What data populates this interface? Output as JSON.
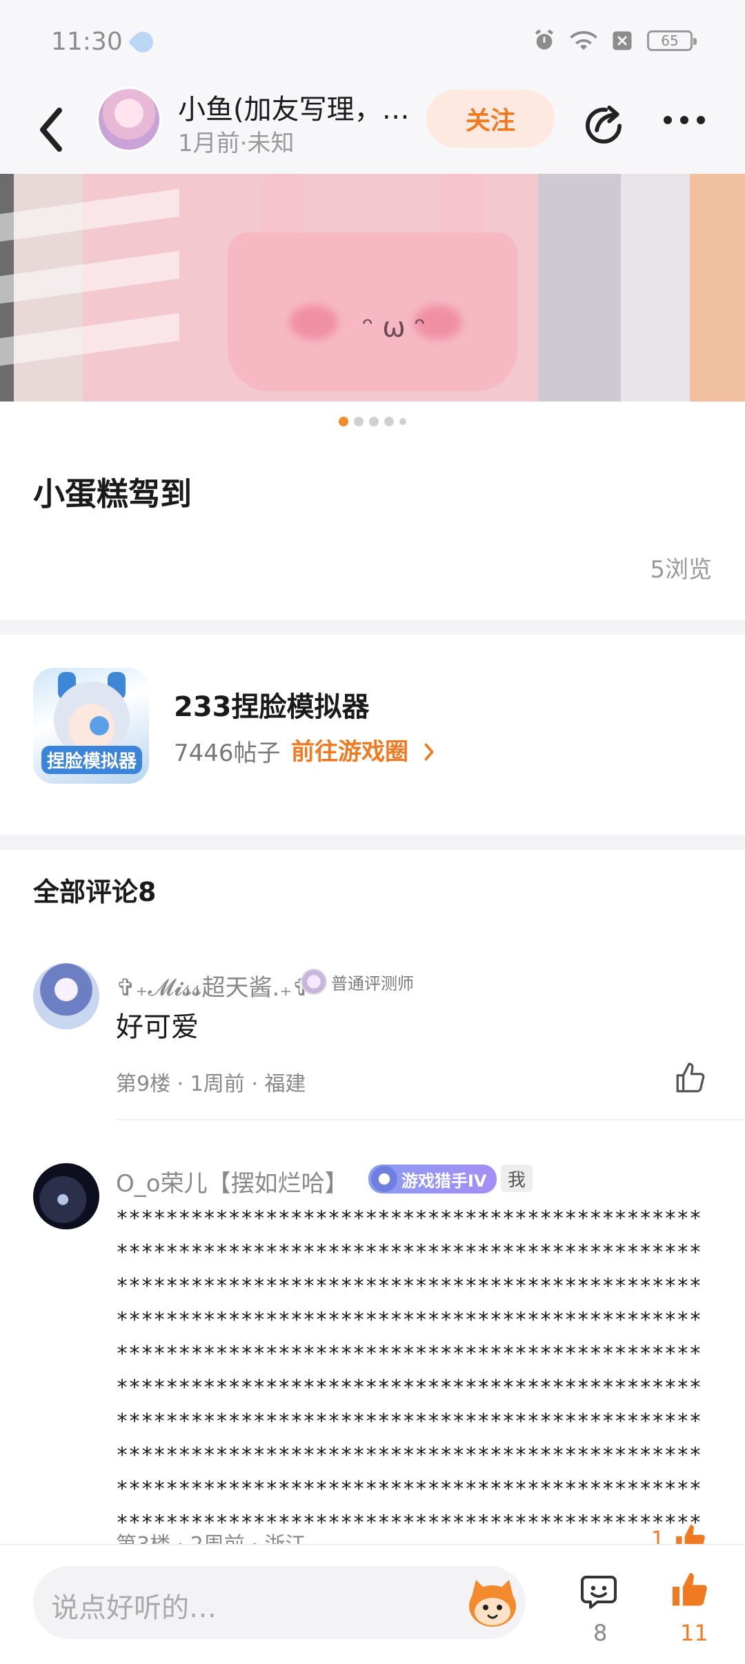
{
  "status_bar": {
    "time": "11:30",
    "battery": "65"
  },
  "header": {
    "author_name": "小鱼(加友写理，…",
    "post_meta": "1月前·未知",
    "follow_label": "关注"
  },
  "post": {
    "image_pages": 5,
    "active_page": 1,
    "title": "小蛋糕驾到",
    "views": "5浏览"
  },
  "game": {
    "name": "233捏脸模拟器",
    "posts": "7446帖子",
    "link_label": "前往游戏圈",
    "icon_logo_text": "捏脸模拟器"
  },
  "comments_section": {
    "title": "全部评论8"
  },
  "comments": [
    {
      "user": "✞₊𝓜𝓲𝓼𝓼超天酱.₊✞",
      "badge": "普通评测师",
      "text": "好可爱",
      "meta": "第9楼 · 1周前 · 福建"
    },
    {
      "user": "O_o荣儿【摆如烂哈】",
      "badge": "游戏猎手IV",
      "tag": "我",
      "text": "****************************************************************************************************************************************************************************************************************************************************************************************************************************************************************************************************************************************************************************************************************************************************************************************************************************************************************************************************************",
      "meta": "第3楼 · 2周前 · 浙江",
      "likes": "1"
    }
  ],
  "bottom_bar": {
    "input_placeholder": "说点好听的…",
    "comment_count": "8",
    "like_count": "11"
  },
  "colors": {
    "accent": "#f07a22",
    "follow_bg": "#fde9e0"
  }
}
